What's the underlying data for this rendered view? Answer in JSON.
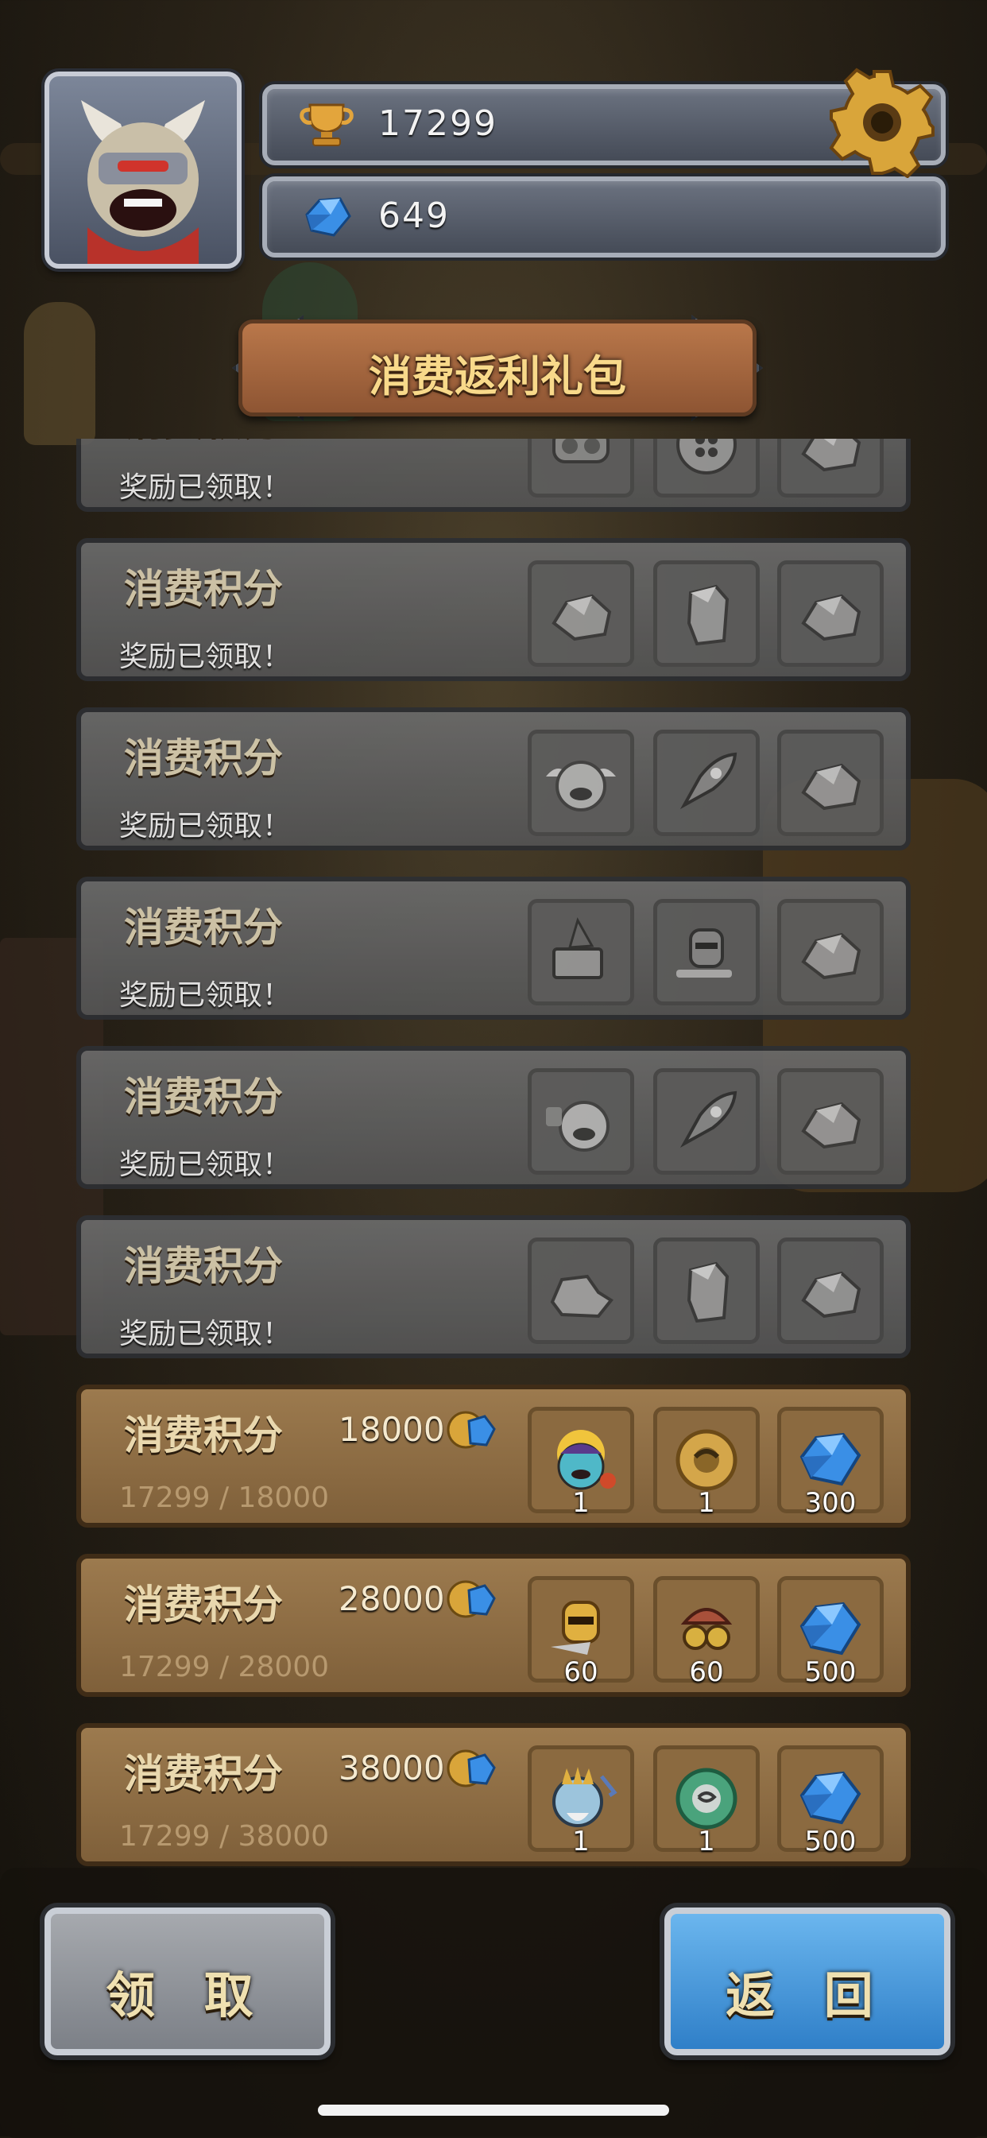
{
  "header": {
    "trophy_count": "17299",
    "gem_count": "649",
    "title": "消费返利礼包"
  },
  "tiers": [
    {
      "title": "消费积分",
      "status": "奖励已领取！",
      "claimed": true,
      "rewards": [
        {
          "icon": "armor-icon"
        },
        {
          "icon": "button-icon"
        },
        {
          "icon": "stone-icon"
        }
      ]
    },
    {
      "title": "消费积分",
      "status": "奖励已领取！",
      "claimed": true,
      "rewards": [
        {
          "icon": "stone-icon"
        },
        {
          "icon": "crystal-icon"
        },
        {
          "icon": "stone-icon"
        }
      ]
    },
    {
      "title": "消费积分",
      "status": "奖励已领取！",
      "claimed": true,
      "rewards": [
        {
          "icon": "winged-hero-icon"
        },
        {
          "icon": "rocket-icon"
        },
        {
          "icon": "stone-icon"
        }
      ]
    },
    {
      "title": "消费积分",
      "status": "奖励已领取！",
      "claimed": true,
      "rewards": [
        {
          "icon": "spellbook-icon"
        },
        {
          "icon": "knight-icon"
        },
        {
          "icon": "stone-icon"
        }
      ]
    },
    {
      "title": "消费积分",
      "status": "奖励已领取！",
      "claimed": true,
      "rewards": [
        {
          "icon": "robot-hero-icon"
        },
        {
          "icon": "rocket-icon"
        },
        {
          "icon": "stone-icon"
        }
      ]
    },
    {
      "title": "消费积分",
      "status": "奖励已领取！",
      "claimed": true,
      "rewards": [
        {
          "icon": "rock-icon"
        },
        {
          "icon": "crystal-icon"
        },
        {
          "icon": "stone-icon"
        }
      ]
    },
    {
      "title": "消费积分",
      "points": "18000",
      "progress": "17299 / 18000",
      "claimed": false,
      "rewards": [
        {
          "icon": "sun-hero-icon",
          "count": "1"
        },
        {
          "icon": "gold-gear-icon",
          "count": "1"
        },
        {
          "icon": "gem-icon",
          "count": "300"
        }
      ]
    },
    {
      "title": "消费积分",
      "points": "28000",
      "progress": "17299 / 28000",
      "claimed": false,
      "rewards": [
        {
          "icon": "gold-knight-icon",
          "count": "60"
        },
        {
          "icon": "goggles-hat-icon",
          "count": "60"
        },
        {
          "icon": "gem-icon",
          "count": "500"
        }
      ]
    },
    {
      "title": "消费积分",
      "points": "38000",
      "progress": "17299 / 38000",
      "claimed": false,
      "rewards": [
        {
          "icon": "trident-hero-icon",
          "count": "1"
        },
        {
          "icon": "green-gear-icon",
          "count": "1"
        },
        {
          "icon": "gem-icon",
          "count": "500"
        }
      ]
    }
  ],
  "buttons": {
    "claim": "领 取",
    "back": "返 回"
  },
  "colors": {
    "gem_blue": "#3a8fe6",
    "gold": "#d9a53a",
    "claim_button": "#9a9da3",
    "back_button": "#4a9ee0"
  }
}
